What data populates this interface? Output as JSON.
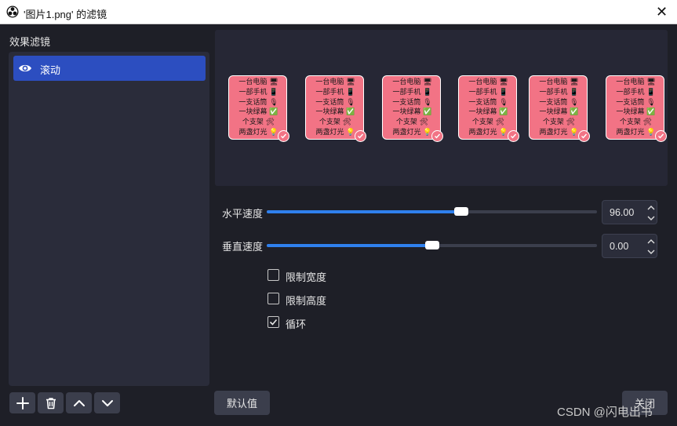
{
  "window": {
    "title": "'图片1.png' 的滤镜",
    "close_glyph": "✕"
  },
  "filters": {
    "heading": "效果滤镜",
    "items": [
      {
        "label": "滚动",
        "visible": true,
        "selected": true
      }
    ]
  },
  "toolbar": {
    "add_icon": "plus-icon",
    "remove_icon": "trash-icon",
    "up_icon": "chevron-up-icon",
    "down_icon": "chevron-down-icon"
  },
  "preview": {
    "card_lines": [
      "一台电脑 🖥",
      "一部手机 📱",
      "一支话筒 🎙",
      "一块绿幕 ✅",
      "个支架 🛠",
      "两盏灯光 💡"
    ],
    "card_count": 6
  },
  "properties": {
    "horizontal_speed": {
      "label": "水平速度",
      "value": "96.00",
      "fraction": 0.59
    },
    "vertical_speed": {
      "label": "垂直速度",
      "value": "0.00",
      "fraction": 0.5
    },
    "limit_width": {
      "label": "限制宽度",
      "checked": false
    },
    "limit_height": {
      "label": "限制高度",
      "checked": false
    },
    "loop": {
      "label": "循环",
      "checked": true
    }
  },
  "buttons": {
    "defaults": "默认值",
    "close": "关闭"
  },
  "watermark": "CSDN @闪电出书",
  "colors": {
    "accent": "#2f80ed",
    "selection": "#2c4ec0",
    "card": "#f27385"
  }
}
